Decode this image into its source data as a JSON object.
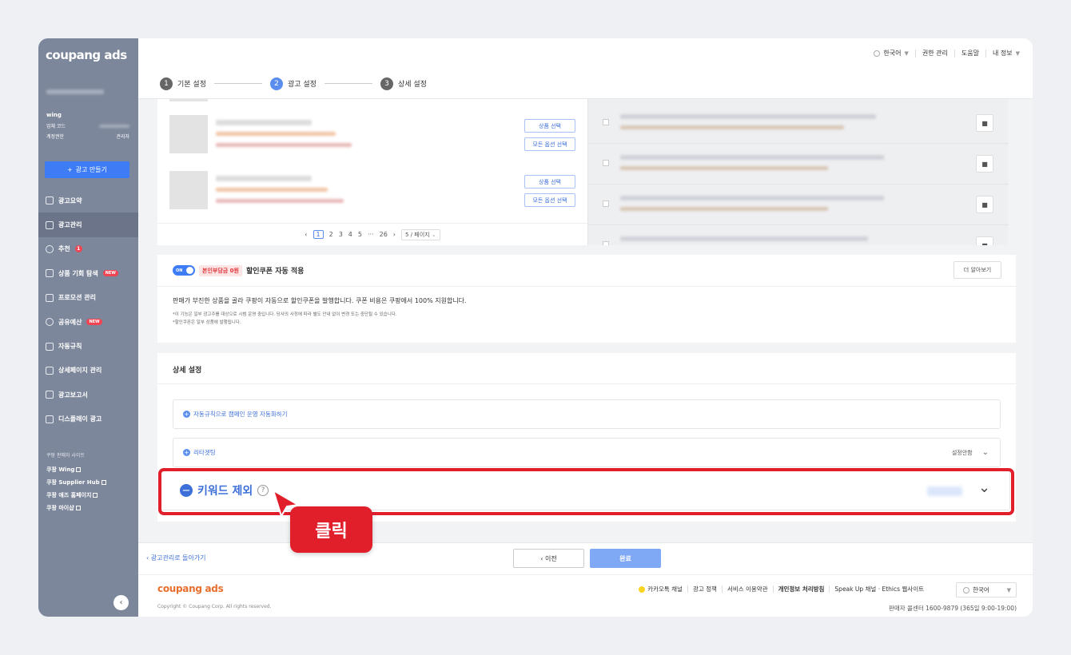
{
  "sidebar": {
    "logo": "coupang ads",
    "account_name": "wing",
    "vendor_code_label": "업체 코드",
    "role_label": "계정권한",
    "role_value": "관리자",
    "create_button": "광고 만들기",
    "menu": [
      {
        "label": "광고요약",
        "icon": "grid-icon"
      },
      {
        "label": "광고관리",
        "icon": "folder-icon",
        "active": true
      },
      {
        "label": "추천",
        "icon": "check-circle-icon",
        "badge": "1"
      },
      {
        "label": "상품 기회 탐색",
        "icon": "bag-icon",
        "new": "NEW"
      },
      {
        "label": "프로모션 관리",
        "icon": "megaphone-icon"
      },
      {
        "label": "공유예산",
        "icon": "check-circle-icon",
        "new": "NEW"
      },
      {
        "label": "자동규칙",
        "icon": "wrench-icon"
      },
      {
        "label": "상세페이지 관리",
        "icon": "document-icon"
      },
      {
        "label": "광고보고서",
        "icon": "bar-chart-icon"
      },
      {
        "label": "디스플레이 광고",
        "icon": "display-icon"
      }
    ],
    "sites_title": "쿠팡 판매자 사이트",
    "sites": [
      "쿠팡 Wing",
      "쿠팡 Supplier Hub",
      "쿠팡 애즈 홈페이지",
      "쿠팡 마이샵"
    ],
    "collapse_icon": "chevron-left-icon"
  },
  "topbar": {
    "language": "한국어",
    "permissions": "권한 관리",
    "help": "도움말",
    "my_info": "내 정보"
  },
  "steps": [
    {
      "num": "1",
      "label": "기본 설정"
    },
    {
      "num": "2",
      "label": "광고 설정",
      "active": true
    },
    {
      "num": "3",
      "label": "상세 설정"
    }
  ],
  "products": {
    "select_button": "상품 선택",
    "all_options_button": "모든 옵션 선택",
    "pagination": {
      "pages": [
        "1",
        "2",
        "3",
        "4",
        "5"
      ],
      "ellipsis": "···",
      "last": "26",
      "page_size": "5 / 페이지"
    }
  },
  "coupon": {
    "toggle_label": "ON",
    "badge": "본인부담금 0원",
    "title": "할인쿠폰 자동 적용",
    "more_button": "더 알아보기",
    "description": "판매가 부진한 상품을 골라 쿠팡이 자동으로 할인쿠폰을 발행합니다. 쿠폰 비용은 쿠팡에서 100% 지원합니다.",
    "note1": "*이 기능은 일부 광고주를 대상으로 시범 운영 중입니다. 당사의 사정에 따라 별도 안내 없이 변경 또는 중단될 수 있습니다.",
    "note2": "*할인쿠폰은 일부 상품에 발행됩니다."
  },
  "detail": {
    "title": "상세 설정",
    "auto_rule": "자동규칙으로 캠페인 운영 자동화하기",
    "retargeting": "리타겟팅",
    "retargeting_status": "설정안함",
    "keyword_exclusion": "키워드 제외",
    "click_label": "클릭"
  },
  "bottom": {
    "back_link": "광고관리로 돌아가기",
    "prev_button": "이전",
    "done_button": "완료"
  },
  "footer": {
    "logo": "coupang ads",
    "copyright": "Copyright © Coupang Corp. All rights reserved.",
    "links": [
      "카카오톡 채널",
      "광고 정책",
      "서비스 이용약관",
      "개인정보 처리방침",
      "Speak Up 채널 · Ethics 웹사이트"
    ],
    "language": "한국어",
    "seller_center": "판매자 콜센터 1600-9879 (365일 9:00-19:00)"
  },
  "colors": {
    "accent": "#3d7cf5",
    "highlight": "#e11f2b",
    "sidebar": "#7d879b"
  }
}
